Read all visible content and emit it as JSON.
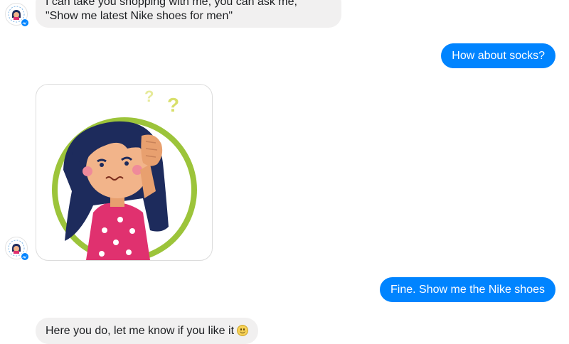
{
  "messages": [
    {
      "id": "m1",
      "direction": "incoming",
      "lines": [
        "I can take you shopping with me, you can ask me,",
        "\"Show me latest Nike shoes for men\""
      ]
    },
    {
      "id": "m2",
      "direction": "outgoing",
      "text": "How about socks?"
    },
    {
      "id": "m3",
      "direction": "incoming",
      "type": "sticker",
      "sticker": "confused-girl-sticker"
    },
    {
      "id": "m4",
      "direction": "outgoing",
      "text": "Fine. Show me the Nike shoes"
    },
    {
      "id": "m5",
      "direction": "incoming",
      "text": "Here you do, let me know if you like it",
      "emoji": "smiley-emoji"
    }
  ],
  "colors": {
    "outgoing_bubble": "#0084ff",
    "incoming_bubble": "#f1f0f0",
    "sticker_circle": "#9cc43a",
    "hair": "#1d2b5c",
    "dress": "#e0316f"
  },
  "avatar": {
    "icon": "bot-avatar-icon",
    "badge": "messenger-badge-icon"
  }
}
